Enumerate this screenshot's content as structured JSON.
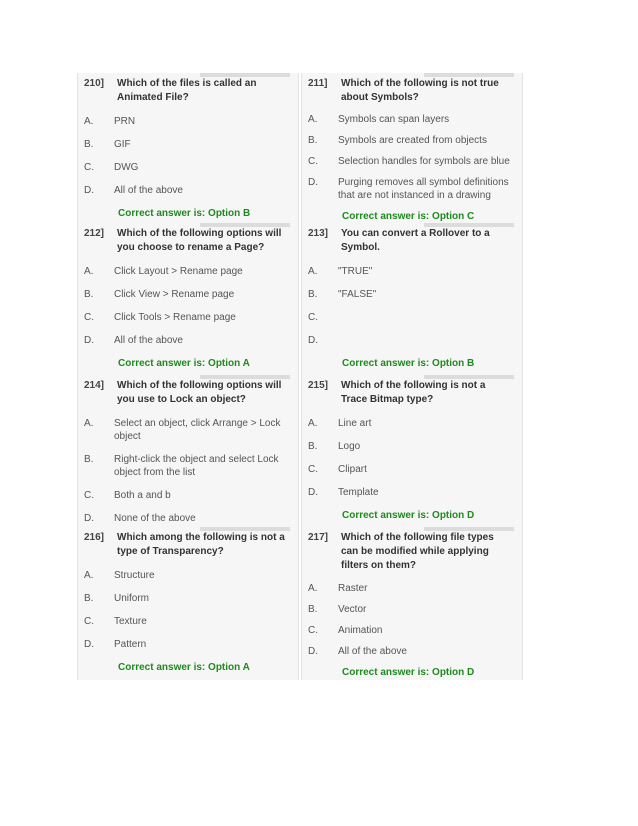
{
  "answer_prefix": "Correct answer is: ",
  "questions": [
    {
      "num": "210]",
      "text": "Which of the files is called an Animated File?",
      "options": [
        {
          "letter": "A.",
          "text": "PRN"
        },
        {
          "letter": "B.",
          "text": "GIF"
        },
        {
          "letter": "C.",
          "text": "DWG"
        },
        {
          "letter": "D.",
          "text": "All of the above"
        }
      ],
      "answer": "Correct answer is: Option B"
    },
    {
      "num": "211]",
      "text": "Which of the following is not true about Symbols?",
      "options": [
        {
          "letter": "A.",
          "text": "Symbols can span layers"
        },
        {
          "letter": "B.",
          "text": "Symbols are created from objects"
        },
        {
          "letter": "C.",
          "text": "Selection handles for symbols are blue"
        },
        {
          "letter": "D.",
          "text": "Purging removes all symbol definitions that are not instanced in a drawing"
        }
      ],
      "answer": "Correct answer is: Option C"
    },
    {
      "num": "212]",
      "text": "Which of the following options will you choose to rename a Page?",
      "options": [
        {
          "letter": "A.",
          "text": "Click Layout > Rename page"
        },
        {
          "letter": "B.",
          "text": "Click View > Rename page"
        },
        {
          "letter": "C.",
          "text": "Click Tools > Rename page"
        },
        {
          "letter": "D.",
          "text": "All of the above"
        }
      ],
      "answer": "Correct answer is: Option A"
    },
    {
      "num": "213]",
      "text": "You can convert a Rollover to a Symbol.",
      "options": [
        {
          "letter": "A.",
          "text": "\"TRUE\""
        },
        {
          "letter": "B.",
          "text": "\"FALSE\""
        },
        {
          "letter": "C.",
          "text": ""
        },
        {
          "letter": "D.",
          "text": ""
        }
      ],
      "answer": "Correct answer is: Option B"
    },
    {
      "num": "214]",
      "text": "Which of the following options will you use to Lock an object?",
      "options": [
        {
          "letter": "A.",
          "text": "Select an object, click Arrange > Lock object"
        },
        {
          "letter": "B.",
          "text": "Right-click the object and select Lock object from the list"
        },
        {
          "letter": "C.",
          "text": "Both a and b"
        },
        {
          "letter": "D.",
          "text": "None of the above"
        }
      ],
      "answer": ""
    },
    {
      "num": "215]",
      "text": "Which of the following is not a Trace Bitmap type?",
      "options": [
        {
          "letter": "A.",
          "text": "Line art"
        },
        {
          "letter": "B.",
          "text": "Logo"
        },
        {
          "letter": "C.",
          "text": "Clipart"
        },
        {
          "letter": "D.",
          "text": "Template"
        }
      ],
      "answer": "Correct answer is: Option D"
    },
    {
      "num": "216]",
      "text": "Which among the following is not a type of Transparency?",
      "options": [
        {
          "letter": "A.",
          "text": "Structure"
        },
        {
          "letter": "B.",
          "text": "Uniform"
        },
        {
          "letter": "C.",
          "text": "Texture"
        },
        {
          "letter": "D.",
          "text": "Pattern"
        }
      ],
      "answer": "Correct answer is: Option A"
    },
    {
      "num": "217]",
      "text": "Which of the following file types can be modified while applying filters on them?",
      "options": [
        {
          "letter": "A.",
          "text": "Raster"
        },
        {
          "letter": "B.",
          "text": "Vector"
        },
        {
          "letter": "C.",
          "text": "Animation"
        },
        {
          "letter": "D.",
          "text": "All of the above"
        }
      ],
      "answer": "Correct answer is: Option D"
    }
  ]
}
